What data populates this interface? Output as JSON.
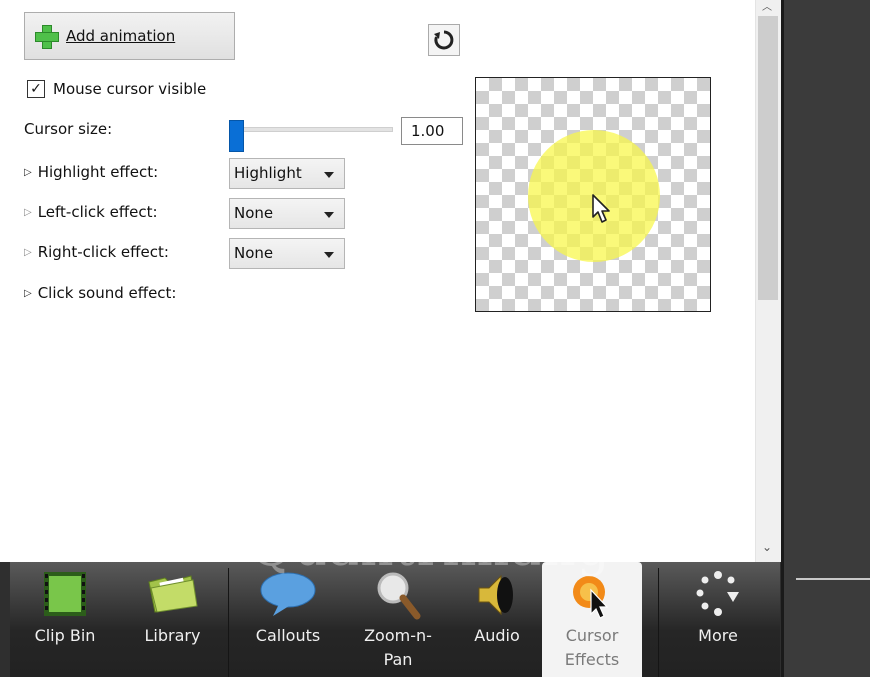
{
  "toolbar_top": {
    "add_animation_label": "Add animation"
  },
  "cursor": {
    "visible_checkbox_label": "Mouse cursor visible",
    "visible_checked": true,
    "size_label": "Cursor size:",
    "size_value": "1.00",
    "size_slider_fraction": 0
  },
  "effects": {
    "highlight": {
      "label": "Highlight effect:",
      "value": "Highlight"
    },
    "left_click": {
      "label": "Left-click effect:",
      "value": "None"
    },
    "right_click": {
      "label": "Right-click effect:",
      "value": "None"
    },
    "click_sound": {
      "label": "Click sound effect:"
    }
  },
  "preview": {
    "highlight_color": "#f8f646"
  },
  "bottom_tabs": [
    {
      "label": "Clip Bin",
      "icon": "film-strip-icon"
    },
    {
      "label": "Library",
      "icon": "folder-icon"
    },
    {
      "label": "Callouts",
      "icon": "speech-bubble-icon"
    },
    {
      "label": "Zoom-n-\nPan",
      "icon": "magnifier-icon"
    },
    {
      "label": "Audio",
      "icon": "speaker-icon"
    },
    {
      "label": "Cursor\nEffects",
      "icon": "cursor-effects-icon",
      "active": true
    },
    {
      "label": "More",
      "icon": "more-dots-icon"
    }
  ],
  "watermark": "Quantrimang",
  "colors": {
    "accent": "#0a6fd6",
    "highlight": "#f8f646",
    "toolbar_bg": "#2f2f2f"
  }
}
